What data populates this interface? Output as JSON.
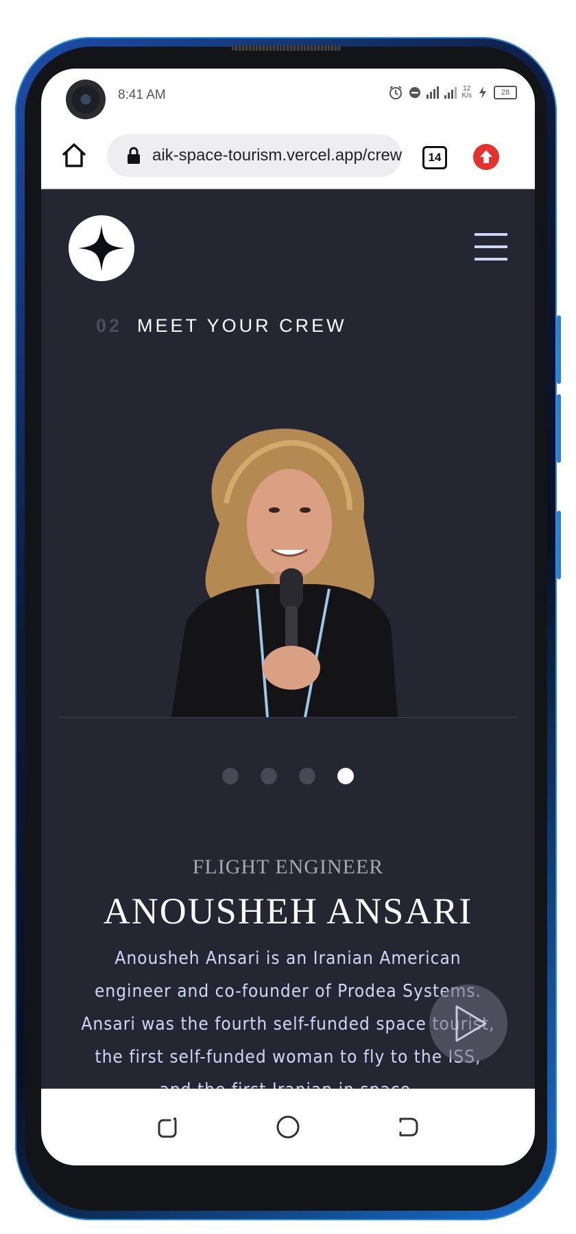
{
  "status_bar": {
    "time": "8:41 AM",
    "network_speed_value": "12",
    "network_speed_unit": "K/s",
    "battery_level": "28"
  },
  "browser": {
    "url": "aik-space-tourism.vercel.app/crew",
    "tab_count": "14"
  },
  "site": {
    "section_number": "02",
    "section_title": "MEET YOUR CREW",
    "pagination": {
      "total": 4,
      "active_index": 3
    },
    "crew_member": {
      "role": "FLIGHT ENGINEER",
      "name": "ANOUSHEH ANSARI",
      "bio": "Anousheh Ansari is an Iranian American engineer and co-founder of Prodea Systems. Ansari was the fourth self-funded space tourist, the first self-funded woman to fly to the ISS, and the first Iranian in space."
    }
  },
  "colors": {
    "site_background": "#242631",
    "accent_text": "#d0d6f9",
    "active_dot": "#ffffff",
    "inactive_dot": "#474a56",
    "update_button": "#e6312d"
  },
  "icons": {
    "home": "home-icon",
    "lock": "lock-icon",
    "logo": "star-logo-icon",
    "menu": "hamburger-menu-icon",
    "play": "play-icon",
    "nav_recents": "recents-icon",
    "nav_home": "circle-home-icon",
    "nav_back": "back-icon"
  }
}
